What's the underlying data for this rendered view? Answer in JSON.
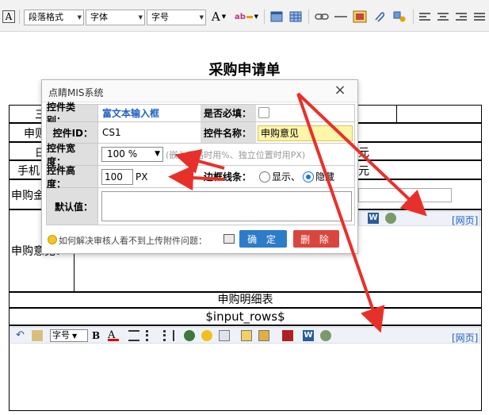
{
  "toolbar": {
    "paragraph_format": "段落格式",
    "font": "字体",
    "font_size": "字号",
    "font_color_glyph": "A",
    "icons": [
      "source-icon",
      "font-color-icon",
      "highlight-icon",
      "table-icon",
      "table-grid-icon",
      "link-icon",
      "hr-icon",
      "image-icon",
      "attach-icon",
      "paint-icon",
      "align-left-icon",
      "align-center-icon",
      "align-right-icon"
    ]
  },
  "doc": {
    "title": "采购申请单",
    "row_labels_partial": [
      "三",
      "申则",
      "日",
      "手机",
      "申购金"
    ],
    "yuan_1": "元",
    "yuan_2": "元",
    "opinion_label": "申购意见：",
    "detail_header": "申购明细表",
    "input_rows": "$input_rows$",
    "web_page_link": "[网页]",
    "font_size_select": "字号"
  },
  "dialog": {
    "title": "点睛MIS系统",
    "close": "×",
    "control_type_label": "控件类别：",
    "control_type_value": "富文本输入框",
    "required_label": "是否必填：",
    "control_id_label": "控件ID：",
    "control_id_value": "CS1",
    "control_name_label": "控件名称：",
    "control_name_value": "申购意见",
    "width_label": "控件宽度：",
    "width_value": "100  %",
    "width_hint": "(嵌入表格时用%、独立位置时用PX)",
    "height_label": "控件高度：",
    "height_value": "100",
    "height_unit": "PX",
    "border_label": "边框线条：",
    "border_show": "显示、",
    "border_hide": "隐藏",
    "default_label": "默认值：",
    "help_text": "如何解决审核人看不到上传附件问题：",
    "confirm": "确 定",
    "delete": "删 除"
  },
  "colors": {
    "arrow": "#e8302a",
    "confirm_btn": "#2d7cc9",
    "delete_btn": "#d9463e",
    "name_field_bg": "#fdf5a8",
    "link": "#1f5fc4"
  }
}
